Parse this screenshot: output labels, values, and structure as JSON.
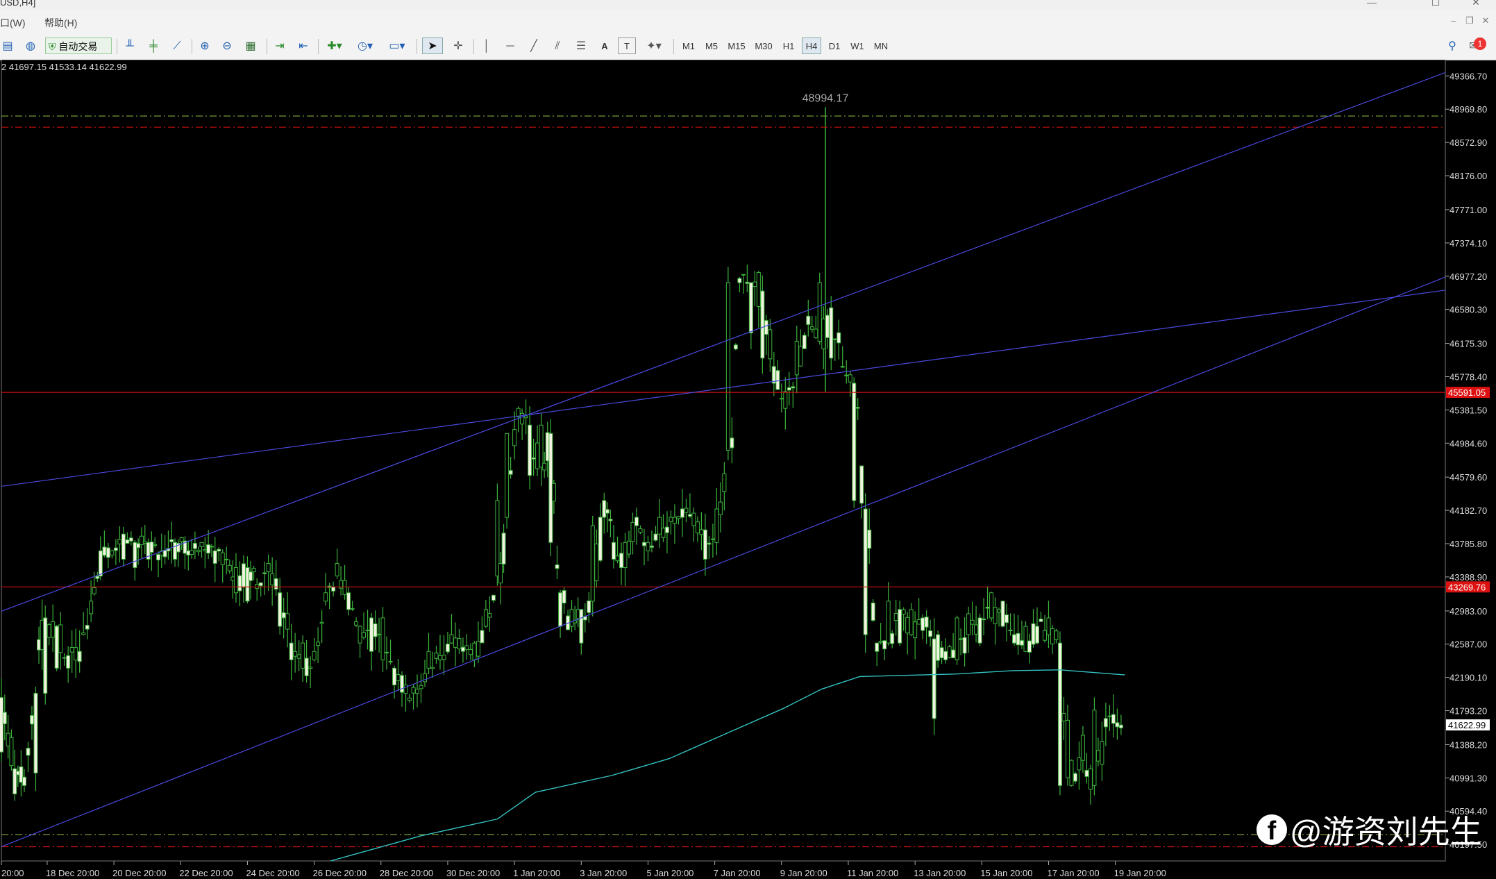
{
  "window": {
    "title": "USD,H4]"
  },
  "menu": {
    "items": [
      "口(W)",
      "帮助(H)"
    ]
  },
  "toolbar": {
    "auto_trade_label": "自动交易",
    "timeframes": [
      "M1",
      "M5",
      "M15",
      "M30",
      "H1",
      "H4",
      "D1",
      "W1",
      "MN"
    ],
    "active_timeframe": "H4",
    "text_tool_label": "A",
    "label_tool_label": "T",
    "alert_count": "1"
  },
  "ohlc_readout": "2 41697.15 41533.14 41622.99",
  "watermark": "@游资刘先生",
  "chart_data": {
    "type": "candlestick",
    "title": "",
    "ylim": [
      40000,
      49560
    ],
    "price_ticks": [
      "49366.70",
      "48969.80",
      "48572.90",
      "48176.00",
      "47771.00",
      "47374.10",
      "46977.20",
      "46580.30",
      "46175.30",
      "45778.40",
      "45381.50",
      "44984.60",
      "44579.60",
      "44182.70",
      "43785.80",
      "43388.90",
      "42983.00",
      "42587.00",
      "42190.10",
      "41793.20",
      "41388.20",
      "40991.30",
      "40594.40",
      "40197.50"
    ],
    "time_labels": [
      "20:00",
      "18 Dec 20:00",
      "20 Dec 20:00",
      "22 Dec 20:00",
      "24 Dec 20:00",
      "26 Dec 20:00",
      "28 Dec 20:00",
      "30 Dec 20:00",
      "1 Jan 20:00",
      "3 Jan 20:00",
      "5 Jan 20:00",
      "7 Jan 20:00",
      "9 Jan 20:00",
      "11 Jan 20:00",
      "13 Jan 20:00",
      "15 Jan 20:00",
      "17 Jan 20:00",
      "19 Jan 20:00"
    ],
    "high_annotation": "48994.17",
    "current_price": "41622.99",
    "horizontal_levels": [
      {
        "price": 45591.05,
        "label": "45591.05",
        "color": "#cc1111",
        "style": "solid"
      },
      {
        "price": 43269.76,
        "label": "43269.76",
        "color": "#cc1111",
        "style": "solid"
      },
      {
        "price": 48888,
        "color": "#7a9a3a",
        "style": "dashdot"
      },
      {
        "price": 48755,
        "color": "#cc1111",
        "style": "dashdot"
      },
      {
        "price": 40315,
        "color": "#7a9a3a",
        "style": "dashdot"
      },
      {
        "price": 40170,
        "color": "#cc1111",
        "style": "dashdot"
      }
    ],
    "trendlines": [
      {
        "p1": [
          0,
          44470
        ],
        "p2": [
          1514,
          46810
        ],
        "color": "#4a4ae0"
      },
      {
        "p1": [
          0,
          42980
        ],
        "p2": [
          1514,
          49407
        ],
        "color": "#4a4ae0"
      },
      {
        "p1": [
          0,
          40170
        ],
        "p2": [
          1514,
          46967
        ],
        "color": "#4a4ae0"
      }
    ],
    "moving_average": {
      "color": "#35c2c2",
      "points": [
        [
          345,
          40000
        ],
        [
          440,
          40300
        ],
        [
          520,
          40500
        ],
        [
          560,
          40820
        ],
        [
          640,
          41020
        ],
        [
          700,
          41220
        ],
        [
          760,
          41520
        ],
        [
          820,
          41820
        ],
        [
          860,
          42050
        ],
        [
          900,
          42200
        ],
        [
          1000,
          42230
        ],
        [
          1060,
          42270
        ],
        [
          1110,
          42280
        ],
        [
          1178,
          42220
        ]
      ]
    },
    "candles_seed": 20240119,
    "candles": [
      [
        0,
        41950,
        41300
      ],
      [
        14,
        41100,
        40800
      ],
      [
        24,
        41000,
        40900
      ],
      [
        36,
        42000,
        41050
      ],
      [
        46,
        42900,
        42000
      ],
      [
        58,
        42800,
        42300
      ],
      [
        70,
        42450,
        42300
      ],
      [
        82,
        42500,
        42380
      ],
      [
        94,
        42950,
        43100
      ],
      [
        104,
        43700,
        43400
      ],
      [
        116,
        43650,
        43700
      ],
      [
        128,
        43900,
        43600
      ],
      [
        140,
        43800,
        43500
      ],
      [
        154,
        43800,
        43600
      ],
      [
        168,
        43650,
        43700
      ],
      [
        182,
        43800,
        43600
      ],
      [
        196,
        43700,
        43650
      ],
      [
        210,
        43750,
        43800
      ],
      [
        224,
        43700,
        43550
      ],
      [
        236,
        43600,
        43600
      ],
      [
        246,
        43200,
        43500
      ],
      [
        258,
        43500,
        43100
      ],
      [
        268,
        43250,
        43300
      ],
      [
        280,
        43450,
        43550
      ],
      [
        292,
        43200,
        42800
      ],
      [
        304,
        42600,
        42400
      ],
      [
        316,
        42300,
        42600
      ],
      [
        328,
        42400,
        42500
      ],
      [
        340,
        43100,
        43200
      ],
      [
        352,
        43400,
        43550
      ],
      [
        364,
        43200,
        43000
      ],
      [
        376,
        42600,
        42800
      ],
      [
        388,
        42900,
        42500
      ],
      [
        400,
        42400,
        42900
      ],
      [
        412,
        42300,
        42100
      ],
      [
        424,
        42000,
        42100
      ],
      [
        436,
        42000,
        42050
      ],
      [
        448,
        42300,
        42500
      ],
      [
        460,
        42400,
        42450
      ],
      [
        472,
        42600,
        42700
      ],
      [
        484,
        42550,
        42500
      ],
      [
        496,
        42400,
        42600
      ],
      [
        508,
        42800,
        43000
      ],
      [
        520,
        43400,
        44300
      ],
      [
        530,
        44100,
        45100
      ],
      [
        542,
        45300,
        45400
      ],
      [
        554,
        45200,
        44600
      ],
      [
        566,
        44700,
        45200
      ],
      [
        576,
        45100,
        43800
      ],
      [
        586,
        43200,
        42800
      ],
      [
        598,
        42800,
        43000
      ],
      [
        608,
        43000,
        42600
      ],
      [
        620,
        43100,
        44000
      ],
      [
        632,
        44300,
        44100
      ],
      [
        642,
        43800,
        43600
      ],
      [
        654,
        43500,
        43800
      ],
      [
        666,
        44100,
        44000
      ],
      [
        678,
        43700,
        43800
      ],
      [
        690,
        43900,
        44100
      ],
      [
        702,
        44050,
        44100
      ],
      [
        714,
        44200,
        44100
      ],
      [
        726,
        44000,
        44150
      ],
      [
        738,
        43950,
        43600
      ],
      [
        750,
        43800,
        44200
      ],
      [
        762,
        44900,
        46900
      ],
      [
        774,
        46950,
        46900
      ],
      [
        786,
        46900,
        46300
      ],
      [
        798,
        46800,
        46000
      ],
      [
        810,
        45900,
        45700
      ],
      [
        822,
        45400,
        45600
      ],
      [
        834,
        45800,
        46200
      ],
      [
        846,
        46500,
        46400
      ],
      [
        858,
        46200,
        46900
      ],
      [
        870,
        46600,
        46000
      ],
      [
        882,
        45900,
        45900
      ],
      [
        894,
        45700,
        44300
      ],
      [
        906,
        44200,
        42700
      ],
      [
        918,
        42600,
        42500
      ],
      [
        930,
        42600,
        43100
      ],
      [
        942,
        43000,
        42600
      ],
      [
        954,
        42700,
        43000
      ],
      [
        966,
        42900,
        42750
      ],
      [
        978,
        42650,
        41700
      ],
      [
        990,
        42500,
        42400
      ],
      [
        1002,
        42400,
        42900
      ],
      [
        1014,
        42700,
        42950
      ],
      [
        1026,
        42900,
        42600
      ],
      [
        1038,
        42900,
        43200
      ],
      [
        1050,
        43100,
        42800
      ],
      [
        1062,
        42700,
        42600
      ],
      [
        1074,
        42500,
        42800
      ],
      [
        1086,
        42800,
        42600
      ],
      [
        1098,
        42700,
        42900
      ],
      [
        1110,
        42600,
        40900
      ],
      [
        1122,
        40900,
        41200
      ],
      [
        1134,
        41200,
        41500
      ],
      [
        1146,
        40900,
        41800
      ],
      [
        1158,
        41700,
        41600
      ],
      [
        1170,
        41650,
        41600
      ],
      [
        1178,
        41650,
        41620
      ]
    ]
  }
}
